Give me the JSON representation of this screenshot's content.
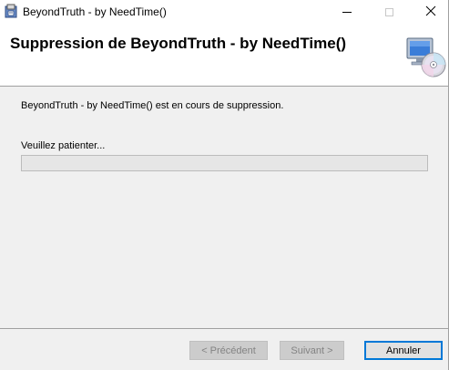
{
  "window": {
    "title": "BeyondTruth - by NeedTime()",
    "icon": "installer-app-icon"
  },
  "titlebar_buttons": {
    "minimize": "minimize-icon",
    "maximize": "maximize-icon",
    "close_glyph": "✕"
  },
  "banner": {
    "title": "Suppression de BeyondTruth - by NeedTime()",
    "icon": "computer-cd-icon"
  },
  "content": {
    "status_message": "BeyondTruth - by NeedTime() est en cours de suppression.",
    "wait_label": "Veuillez patienter...",
    "progress_percent": 0
  },
  "buttons": {
    "previous": "< Précédent",
    "next": "Suivant >",
    "cancel": "Annuler"
  },
  "colors": {
    "accent": "#0078d7",
    "progress_fill": "#06b025"
  }
}
